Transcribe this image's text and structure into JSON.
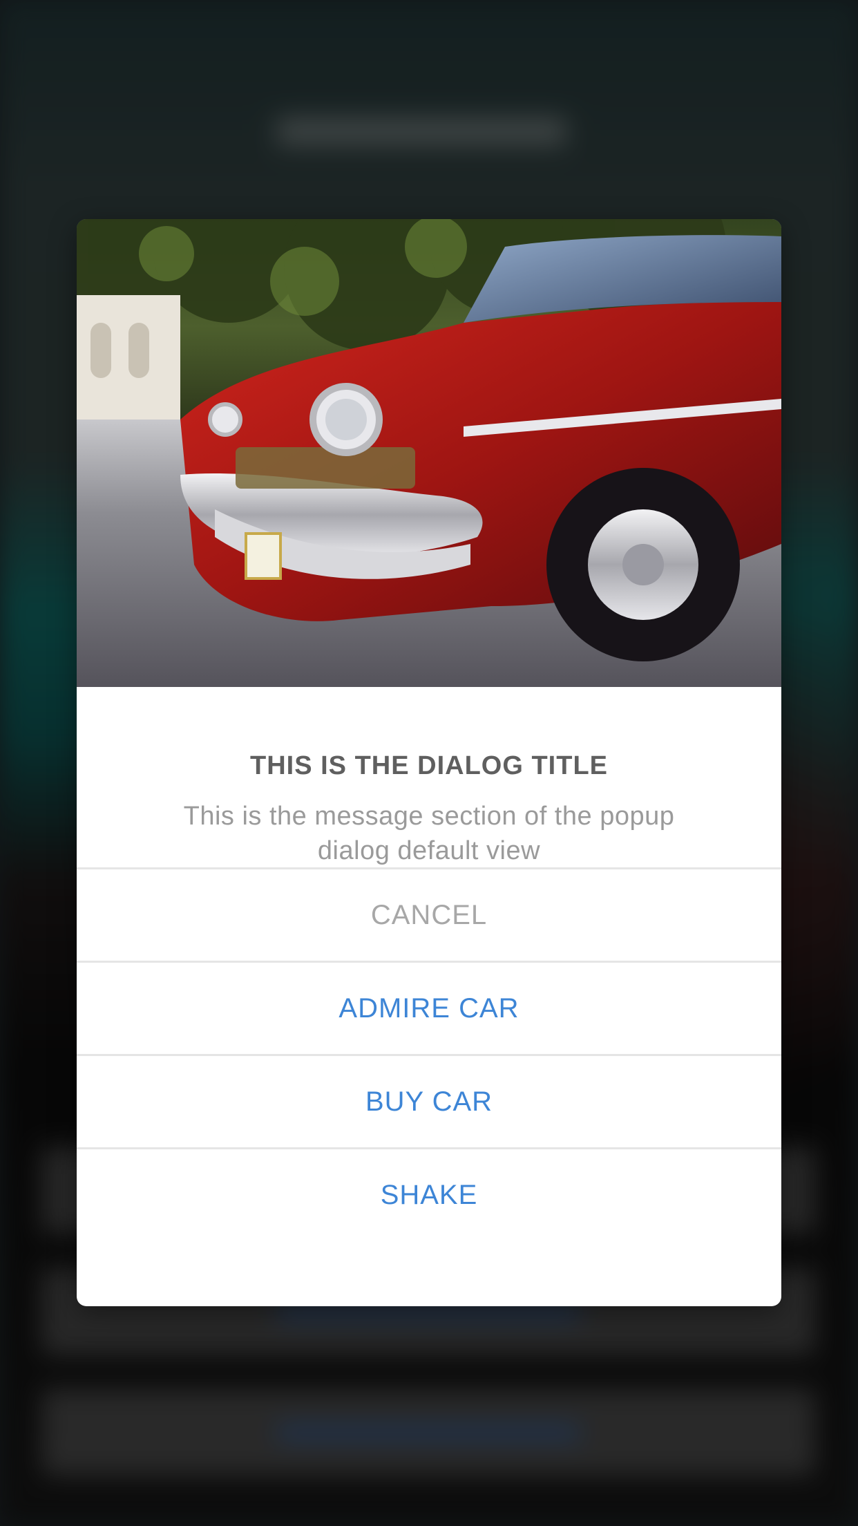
{
  "dialog": {
    "title": "THIS IS THE DIALOG TITLE",
    "message": "This is the message section of the popup dialog default view",
    "image_alt": "red classic car",
    "actions": {
      "cancel": "CANCEL",
      "admire": "ADMIRE CAR",
      "buy": "BUY CAR",
      "shake": "SHAKE"
    }
  },
  "colors": {
    "action_blue": "#3d85d6",
    "cancel_gray": "#a7a7a7",
    "title_gray": "#5f5f5f",
    "message_gray": "#9a9a9a"
  }
}
